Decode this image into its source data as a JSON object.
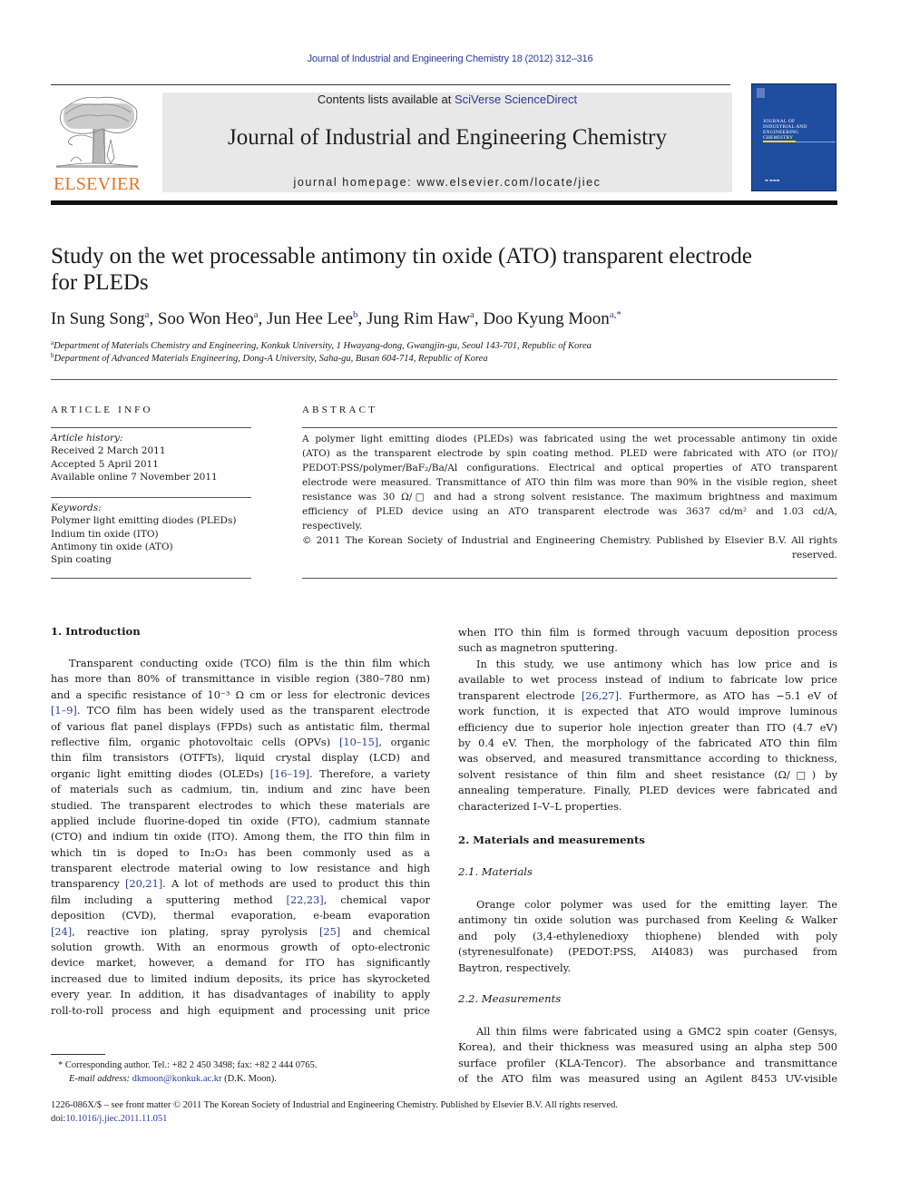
{
  "running_head": "Journal of Industrial and Engineering Chemistry 18 (2012) 312–316",
  "masthead": {
    "contents_prefix": "Contents lists available at ",
    "contents_link": "SciVerse ScienceDirect",
    "journal_name": "Journal of Industrial and Engineering Chemistry",
    "homepage_prefix": "journal homepage: ",
    "homepage_url": "www.elsevier.com/locate/jiec",
    "publisher_logo_text": "ELSEVIER",
    "cover_title_lines": [
      "JOURNAL OF",
      "INDUSTRIAL AND",
      "ENGINEERING",
      "CHEMISTRY"
    ]
  },
  "colors": {
    "link": "#2a3c98",
    "elsevier_orange": "#e8731e",
    "cover_blue": "#1f4da0",
    "masthead_gray": "#e8e8e8"
  },
  "article": {
    "title_line1": "Study on the wet processable antimony tin oxide (ATO) transparent electrode",
    "title_line2": "for PLEDs",
    "authors": [
      {
        "name": "In Sung Song",
        "sup": "a"
      },
      {
        "name": "Soo Won Heo",
        "sup": "a"
      },
      {
        "name": "Jun Hee Lee",
        "sup": "b"
      },
      {
        "name": "Jung Rim Haw",
        "sup": "a"
      },
      {
        "name": "Doo Kyung Moon",
        "sup": "a,*"
      }
    ],
    "affiliations": [
      {
        "sup": "a",
        "text": "Department of Materials Chemistry and Engineering, Konkuk University, 1 Hwayang-dong, Gwangjin-gu, Seoul 143-701, Republic of Korea"
      },
      {
        "sup": "b",
        "text": "Department of Advanced Materials Engineering, Dong-A University, Saha-gu, Busan 604-714, Republic of Korea"
      }
    ]
  },
  "article_info": {
    "heading": "ARTICLE INFO",
    "history_label": "Article history:",
    "received": "Received 2 March 2011",
    "accepted": "Accepted 5 April 2011",
    "online": "Available online 7 November 2011",
    "keywords_label": "Keywords:",
    "keywords": [
      "Polymer light emitting diodes (PLEDs)",
      "Indium tin oxide (ITO)",
      "Antimony tin oxide (ATO)",
      "Spin coating"
    ]
  },
  "abstract": {
    "heading": "ABSTRACT",
    "lines": [
      "A polymer light emitting diodes (PLEDs) was fabricated using the wet processable antimony tin oxide",
      "(ATO) as the transparent electrode by spin coating method. PLED were fabricated with ATO (or ITO)/",
      "PEDOT:PSS/polymer/BaF₂/Ba/Al configurations. Electrical and optical properties of ATO transparent",
      "electrode were measured. Transmittance of ATO thin film was more than 90% in the visible region, sheet",
      "resistance was 30 Ω/□ and had a strong solvent resistance. The maximum brightness and maximum",
      "efficiency of PLED device using an ATO transparent electrode was 3637 cd/m² and 1.03 cd/A,",
      "respectively."
    ],
    "copyright_line1": "© 2011 The Korean Society of Industrial and Engineering Chemistry. Published by Elsevier B.V. All rights",
    "copyright_line2": "reserved."
  },
  "body": {
    "intro_heading": "1.  Introduction",
    "intro_lines": [
      "Transparent conducting oxide (TCO) film is the thin film which",
      "has more than 80% of transmittance in visible region (380–780 nm)",
      "and a specific resistance of 10⁻³ Ω cm or less for electronic devices",
      "[1–9]. TCO film has been widely used as the transparent electrode",
      "of various flat panel displays (FPDs) such as antistatic film, thermal",
      "reflective film, organic photovoltaic cells (OPVs) [10–15], organic",
      "thin film transistors (OTFTs), liquid crystal display (LCD) and",
      "organic light emitting diodes (OLEDs) [16–19]. Therefore, a variety",
      "of materials such as cadmium, tin, indium and zinc have been",
      "studied. The transparent electrodes to which these materials are",
      "applied include fluorine-doped tin oxide (FTO), cadmium stannate",
      "(CTO) and indium tin oxide (ITO). Among them, the ITO thin film in",
      "which tin is doped to In₂O₃ has been commonly used as a",
      "transparent electrode material owing to low resistance and high",
      "transparency [20,21]. A lot of methods are used to product this thin",
      "film including a sputtering method [22,23], chemical vapor",
      "deposition (CVD), thermal evaporation, e-beam evaporation",
      "[24], reactive ion plating, spray pyrolysis [25] and chemical",
      "solution growth. With an enormous growth of opto-electronic",
      "device market, however, a demand for ITO has significantly",
      "increased due to limited indium deposits, its price has skyrocketed",
      "every year. In addition, it has disadvantages of inability to apply",
      "roll-to-roll process and high equipment and processing unit price"
    ],
    "right_lines_a": [
      "when ITO thin film is formed through vacuum deposition process",
      "such as magnetron sputtering."
    ],
    "right_lines_b": [
      "In this study, we use antimony which has low price and is",
      "available to wet process instead of indium to fabricate low price",
      "transparent electrode [26,27]. Furthermore, as ATO has −5.1 eV of",
      "work function, it is expected that ATO would improve luminous",
      "efficiency due to superior hole injection greater than ITO (4.7 eV)",
      "by 0.4 eV. Then, the morphology of the fabricated ATO thin film",
      "was observed, and measured transmittance according to thickness,",
      "solvent resistance of thin film and sheet resistance (Ω/□) by",
      "annealing temperature. Finally, PLED devices were fabricated and",
      "characterized I–V–L properties."
    ],
    "sec2_heading": "2.  Materials and measurements",
    "sec21_heading": "2.1.  Materials",
    "sec21_lines": [
      "Orange color polymer was used for the emitting layer. The",
      "antimony tin oxide solution was purchased from Keeling & Walker",
      "and poly (3,4-ethylenedioxy thiophene) blended with poly",
      "(styrenesulfonate) (PEDOT:PSS, AI4083) was purchased from",
      "Baytron, respectively."
    ],
    "sec22_heading": "2.2.  Measurements",
    "sec22_lines": [
      "All thin films were fabricated using a GMC2 spin coater (Gensys,",
      "Korea), and their thickness was measured using an alpha step 500",
      "surface profiler (KLA-Tencor). The absorbance and transmittance",
      "of the ATO film was measured using an Agilent 8453 UV-visible"
    ]
  },
  "footnote": {
    "marker": "*",
    "corresponding": "Corresponding author. Tel.: +82 2 450 3498; fax: +82 2 444 0765.",
    "email_label": "E-mail address:",
    "email": "dkmoon@konkuk.ac.kr",
    "email_suffix": " (D.K. Moon)."
  },
  "issn_line": "1226-086X/$ – see front matter © 2011 The Korean Society of Industrial and Engineering Chemistry. Published by Elsevier B.V. All rights reserved.",
  "doi_prefix": "doi:",
  "doi": "10.1016/j.jiec.2011.11.051"
}
